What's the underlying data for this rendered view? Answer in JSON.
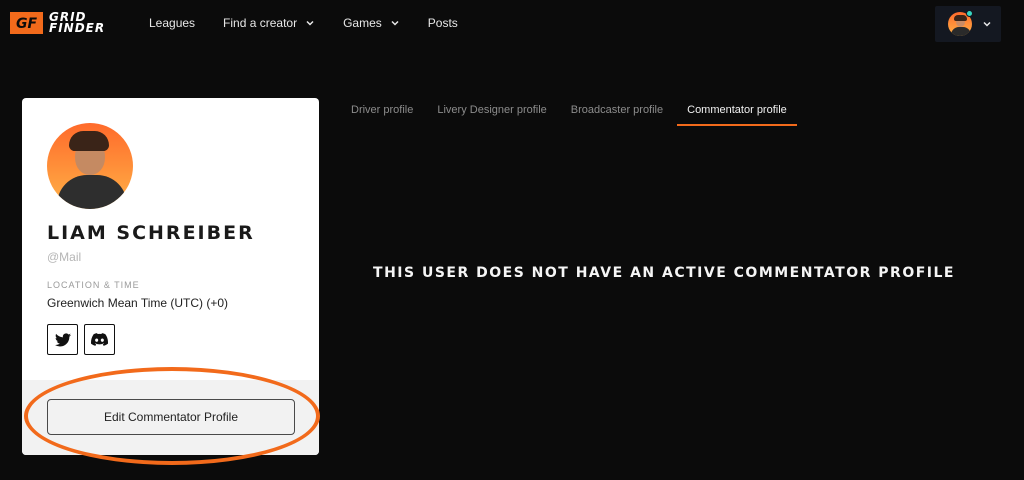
{
  "brand": {
    "logo_mark": "GF",
    "logo_line1": "GRID",
    "logo_line2": "FINDER",
    "accent": "#f26a1b"
  },
  "nav": {
    "items": [
      {
        "label": "Leagues",
        "dropdown": false
      },
      {
        "label": "Find a creator",
        "dropdown": true
      },
      {
        "label": "Games",
        "dropdown": true
      },
      {
        "label": "Posts",
        "dropdown": false
      }
    ]
  },
  "user_menu": {
    "avatar_icon": "user-avatar",
    "status": "online",
    "status_color": "#38d6c2"
  },
  "profile": {
    "name": "LIAM SCHREIBER",
    "handle": "@Mail",
    "location_label": "LOCATION & TIME",
    "location_value": "Greenwich Mean Time (UTC) (+0)",
    "socials": [
      {
        "icon": "twitter-icon"
      },
      {
        "icon": "discord-icon"
      }
    ],
    "edit_button": "Edit Commentator Profile"
  },
  "tabs": [
    {
      "label": "Driver profile",
      "active": false
    },
    {
      "label": "Livery Designer profile",
      "active": false
    },
    {
      "label": "Broadcaster profile",
      "active": false
    },
    {
      "label": "Commentator profile",
      "active": true
    }
  ],
  "content": {
    "empty_message": "THIS USER DOES NOT HAVE AN ACTIVE COMMENTATOR PROFILE"
  }
}
